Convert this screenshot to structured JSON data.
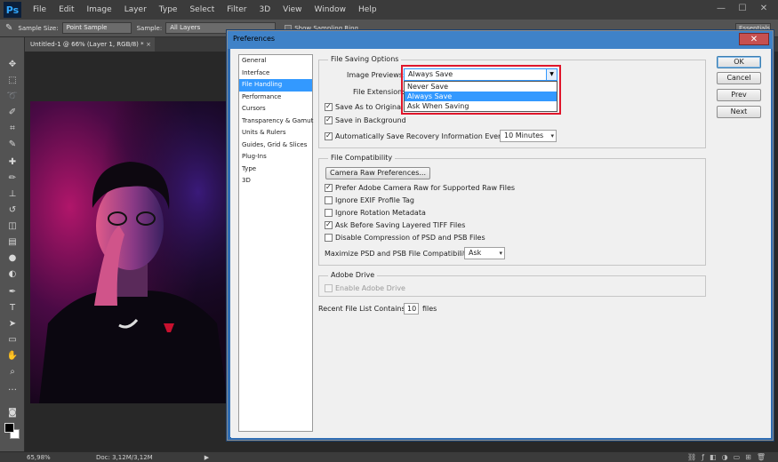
{
  "app": {
    "logo": "Ps",
    "menus": [
      "File",
      "Edit",
      "Image",
      "Layer",
      "Type",
      "Select",
      "Filter",
      "3D",
      "View",
      "Window",
      "Help"
    ],
    "window_controls": [
      "—",
      "☐",
      "✕"
    ]
  },
  "options_bar": {
    "sample_size_label": "Sample Size:",
    "sample_size_value": "Point Sample",
    "sample_label": "Sample:",
    "sample_value": "All Layers",
    "show_ring_label": "Show Sampling Ring",
    "workspace_value": "Essentials"
  },
  "document_tab": {
    "title": "Untitled-1 @ 66% (Layer 1, RGB/8) *",
    "close": "×"
  },
  "status_bar": {
    "zoom": "65,98%",
    "doc": "Doc: 3,12M/3,12M",
    "arrow": "▶"
  },
  "dialog": {
    "title": "Preferences",
    "close": "✕",
    "categories": [
      "General",
      "Interface",
      "File Handling",
      "Performance",
      "Cursors",
      "Transparency & Gamut",
      "Units & Rulers",
      "Guides, Grid & Slices",
      "Plug-Ins",
      "Type",
      "3D"
    ],
    "selected_category": "File Handling",
    "file_saving": {
      "legend": "File Saving Options",
      "image_previews_label": "Image Previews:",
      "image_previews_value": "Always Save",
      "image_previews_options": [
        "Never Save",
        "Always Save",
        "Ask When Saving"
      ],
      "file_extension_label": "File Extension:",
      "save_as_original_label": "Save As to Original F",
      "save_as_original_checked": true,
      "save_in_background_label": "Save in Background",
      "save_in_background_checked": true,
      "auto_recovery_label": "Automatically Save Recovery Information Every:",
      "auto_recovery_checked": true,
      "auto_recovery_value": "10 Minutes"
    },
    "file_compat": {
      "legend": "File Compatibility",
      "camera_raw_button": "Camera Raw Preferences...",
      "checks": [
        {
          "label": "Prefer Adobe Camera Raw for Supported Raw Files",
          "checked": true
        },
        {
          "label": "Ignore EXIF Profile Tag",
          "checked": false
        },
        {
          "label": "Ignore Rotation Metadata",
          "checked": false
        },
        {
          "label": "Ask Before Saving Layered TIFF Files",
          "checked": true
        },
        {
          "label": "Disable Compression of PSD and PSB Files",
          "checked": false
        }
      ],
      "maximize_label": "Maximize PSD and PSB File Compatibility:",
      "maximize_value": "Ask"
    },
    "adobe_drive": {
      "legend": "Adobe Drive",
      "enable_label": "Enable Adobe Drive",
      "enable_checked": false
    },
    "recent_files": {
      "label": "Recent File List Contains:",
      "value": "10",
      "suffix": "files"
    },
    "buttons": {
      "ok": "OK",
      "cancel": "Cancel",
      "prev": "Prev",
      "next": "Next"
    }
  }
}
